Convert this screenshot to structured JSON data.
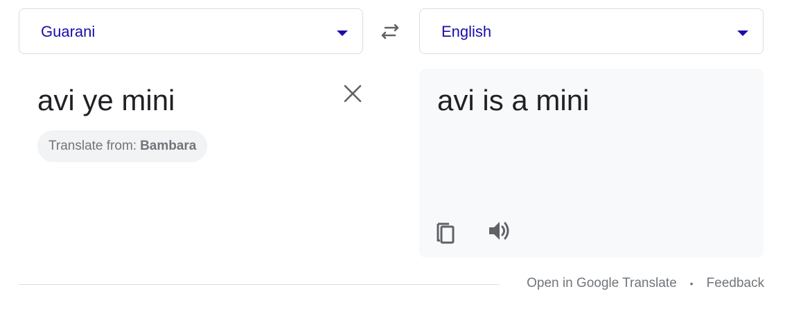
{
  "source_language": {
    "label": "Guarani",
    "icon": "chevron-down-icon"
  },
  "target_language": {
    "label": "English",
    "icon": "chevron-down-icon"
  },
  "swap": {
    "icon": "swap-arrows-icon"
  },
  "source": {
    "text": "avi ye mini",
    "clear_icon": "close-icon",
    "detect_prefix": "Translate from:",
    "detect_language": "Bambara"
  },
  "target": {
    "text": "avi is a mini",
    "copy_icon": "copy-icon",
    "listen_icon": "speaker-icon"
  },
  "footer": {
    "open_link": "Open in Google Translate",
    "separator": "•",
    "feedback_link": "Feedback"
  },
  "colors": {
    "accent": "#1a0dab",
    "border": "#dadce0",
    "muted_text": "#70757a",
    "text": "#202124",
    "result_bg": "#f8f9fa",
    "chip_bg": "#f1f3f4"
  }
}
